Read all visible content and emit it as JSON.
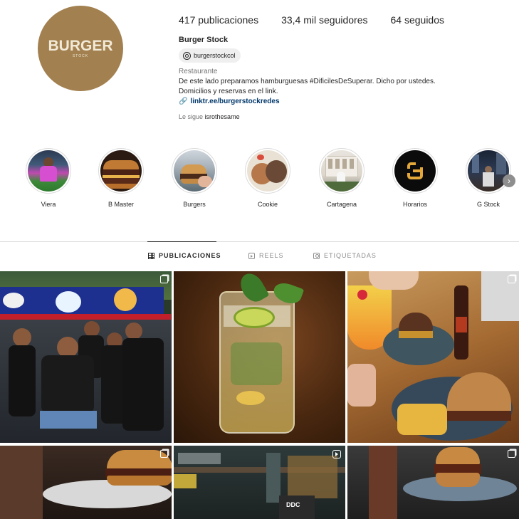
{
  "profile": {
    "avatar_logo": "BURGER",
    "avatar_logo_sub": "STOCK",
    "username": "Burger Stock",
    "threads_handle": "burgerstockcol",
    "category": "Restaurante",
    "bio_line1": "De este lado preparamos hamburguesas #DificilesDeSuperar.  Dicho por ustedes.",
    "bio_line2": "Domicilios y reservas en el link.",
    "link": "linktr.ee/burgerstockredes",
    "followed_by_prefix": "Le sigue",
    "followed_by_user": "isrothesame"
  },
  "stats": {
    "posts": "417 publicaciones",
    "followers": "33,4 mil seguidores",
    "following": "64 seguidos"
  },
  "highlights": [
    {
      "label": "Viera",
      "icon": "soccer-player-photo"
    },
    {
      "label": "B Master",
      "icon": "burger-photo"
    },
    {
      "label": "Burgers",
      "icon": "burger-hand-photo"
    },
    {
      "label": "Cookie",
      "icon": "cookie-photo"
    },
    {
      "label": "Cartagena",
      "icon": "building-photo"
    },
    {
      "label": "Horarios",
      "icon": "g-logo"
    },
    {
      "label": "G Stock",
      "icon": "night-photo"
    }
  ],
  "tabs": [
    {
      "label": "PUBLICACIONES",
      "icon": "grid-icon",
      "active": true
    },
    {
      "label": "REELS",
      "icon": "reels-icon",
      "active": false
    },
    {
      "label": "ETIQUETADAS",
      "icon": "tag-icon",
      "active": false
    }
  ],
  "posts": [
    {
      "name": "team-photo",
      "badge": "multi-icon"
    },
    {
      "name": "mojito-drink",
      "badge": "none"
    },
    {
      "name": "burger-and-cocktail",
      "badge": "multi-icon"
    },
    {
      "name": "burger-on-plate",
      "badge": "multi-icon"
    },
    {
      "name": "bar-interior",
      "badge": "reel-icon",
      "sign": "DDC"
    },
    {
      "name": "burger-served",
      "badge": "multi-icon"
    }
  ]
}
